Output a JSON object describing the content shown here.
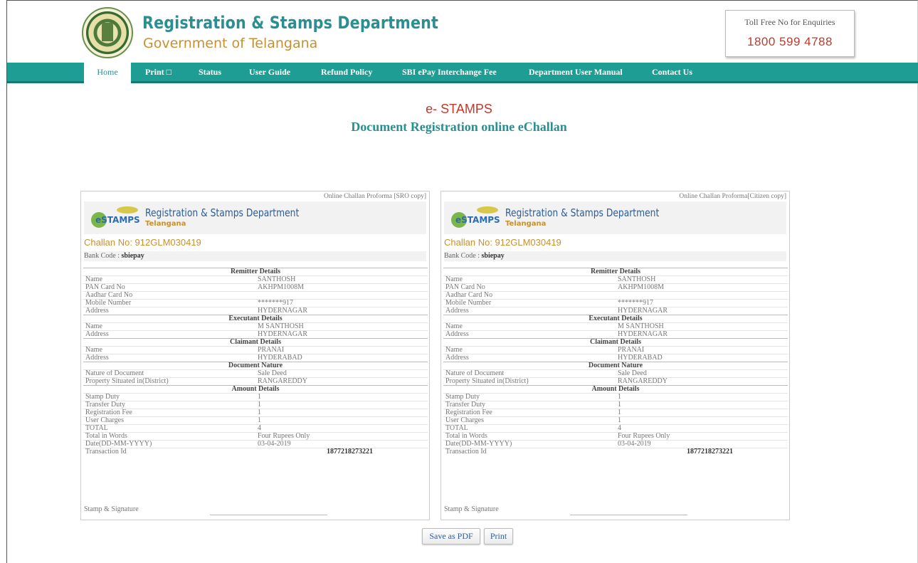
{
  "header": {
    "dept_title": "Registration & Stamps Department",
    "dept_subtitle": "Government of Telangana",
    "toll_label": "Toll Free No for Enquiries",
    "toll_number": "1800 599 4788"
  },
  "nav": [
    {
      "label": "Home"
    },
    {
      "label": "Print □"
    },
    {
      "label": "Status"
    },
    {
      "label": "User Guide"
    },
    {
      "label": "Refund Policy"
    },
    {
      "label": "SBI ePay Interchange Fee"
    },
    {
      "label": "Department User Manual"
    },
    {
      "label": "Contact Us"
    }
  ],
  "page": {
    "estamps": "e- STAMPS",
    "title": "Document Registration online eChallan"
  },
  "challan": {
    "logo_title": "Registration & Stamps Department",
    "logo_state": "Telangana",
    "logo_text": "eSTAMPS",
    "challan_no": "Challan No:  912GLM030419",
    "bank_label": "Bank Code   :",
    "bank_value": "sbiepay",
    "remitter_title": "Remitter Details",
    "remitter": [
      [
        "Name",
        "SANTHOSH"
      ],
      [
        "PAN Card No",
        "AKHPM1008M"
      ],
      [
        "Aadhar Card No",
        ""
      ],
      [
        "Mobile Number",
        "*******917"
      ],
      [
        "Address",
        "HYDERNAGAR"
      ]
    ],
    "executant_title": "Executant Details",
    "executant": [
      [
        "Name",
        "M SANTHOSH"
      ],
      [
        "Address",
        "HYDERNAGAR"
      ]
    ],
    "claimant_title": "Claimant Details",
    "claimant": [
      [
        "Name",
        "PRANAI"
      ],
      [
        "Address",
        "HYDERABAD"
      ]
    ],
    "document_title": "Document Nature",
    "document": [
      [
        "Nature of Document",
        "Sale Deed"
      ],
      [
        "Property Situated in(District)",
        "RANGAREDDY"
      ]
    ],
    "amount_title": "Amount Details",
    "amount": [
      [
        "Stamp Duty",
        "1"
      ],
      [
        "Transfer Duty",
        "1"
      ],
      [
        "Registration Fee",
        "1"
      ],
      [
        "User Charges",
        "1"
      ],
      [
        "TOTAL",
        "4"
      ],
      [
        "Total in Words",
        "Four Rupees Only"
      ],
      [
        "Date(DD-MM-YYYY)",
        "03-04-2019"
      ]
    ],
    "txn_label": "Transaction Id",
    "txn_value": "1877218273221",
    "sign_label": "Stamp & Signature"
  },
  "panels": [
    {
      "proforma": "Online Challan Proforma [SRO copy]"
    },
    {
      "proforma": "Online Challan Proforma[Citizen copy]"
    }
  ],
  "buttons": {
    "save_pdf": "Save as PDF",
    "print": "Print"
  }
}
